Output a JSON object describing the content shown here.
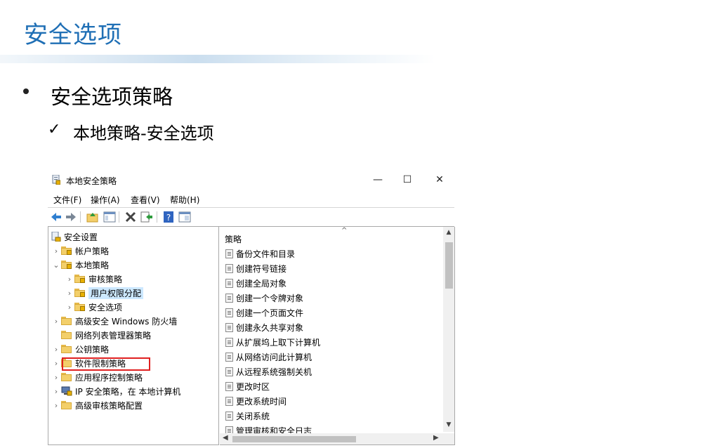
{
  "slide": {
    "title": "安全选项",
    "bullet": "安全选项策略",
    "check_symbol": "✓",
    "sub_bullet": "本地策略-安全选项"
  },
  "window": {
    "title": "本地安全策略",
    "minimize": "—",
    "maximize": "☐",
    "close": "✕"
  },
  "menu": [
    "文件(F)",
    "操作(A)",
    "查看(V)",
    "帮助(H)"
  ],
  "toolbar_icons": [
    "back-arrow-icon",
    "forward-arrow-icon",
    "up-folder-icon",
    "show-hide-tree-icon",
    "delete-icon",
    "export-list-icon",
    "help-icon",
    "properties-icon"
  ],
  "tree": [
    {
      "label": "安全设置",
      "level": 0,
      "chevron": "",
      "icon": "security-settings-icon"
    },
    {
      "label": "帐户策略",
      "level": 1,
      "chevron": "›",
      "icon": "locked-folder-icon"
    },
    {
      "label": "本地策略",
      "level": 1,
      "chevron": "⌄",
      "icon": "locked-folder-icon"
    },
    {
      "label": "审核策略",
      "level": 2,
      "chevron": "›",
      "icon": "locked-folder-icon"
    },
    {
      "label": "用户权限分配",
      "level": 2,
      "chevron": "›",
      "icon": "locked-folder-icon",
      "selected": true
    },
    {
      "label": "安全选项",
      "level": 2,
      "chevron": "›",
      "icon": "locked-folder-icon",
      "highlighted": true
    },
    {
      "label": "高级安全 Windows 防火墙",
      "level": 1,
      "chevron": "›",
      "icon": "folder-icon"
    },
    {
      "label": "网络列表管理器策略",
      "level": 1,
      "chevron": "",
      "icon": "folder-icon"
    },
    {
      "label": "公钥策略",
      "level": 1,
      "chevron": "›",
      "icon": "folder-icon"
    },
    {
      "label": "软件限制策略",
      "level": 1,
      "chevron": "›",
      "icon": "folder-icon"
    },
    {
      "label": "应用程序控制策略",
      "level": 1,
      "chevron": "›",
      "icon": "folder-icon"
    },
    {
      "label": "IP 安全策略，在 本地计算机",
      "level": 1,
      "chevron": "›",
      "icon": "ip-security-icon"
    },
    {
      "label": "高级审核策略配置",
      "level": 1,
      "chevron": "›",
      "icon": "folder-icon"
    }
  ],
  "policy_list": {
    "column_header": "策略",
    "items": [
      "备份文件和目录",
      "创建符号链接",
      "创建全局对象",
      "创建一个令牌对象",
      "创建一个页面文件",
      "创建永久共享对象",
      "从扩展坞上取下计算机",
      "从网络访问此计算机",
      "从远程系统强制关机",
      "更改时区",
      "更改系统时间",
      "关闭系统",
      "管理审核和安全日志"
    ]
  },
  "colors": {
    "title_blue": "#1f6fb5",
    "highlight_red": "#e02020",
    "selection_blue": "#cce8ff"
  }
}
